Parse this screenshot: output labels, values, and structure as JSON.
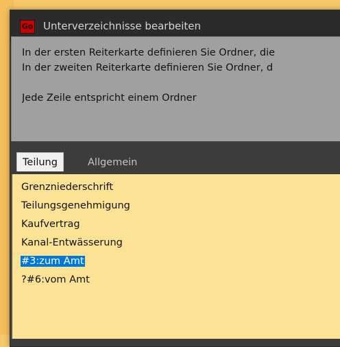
{
  "window": {
    "icon_text": "Go",
    "title": "Unterverzeichnisse bearbeiten"
  },
  "description": {
    "line1": "In der ersten Reiterkarte definieren Sie Ordner, die",
    "line2": "In der zweiten Reiterkarte definieren Sie Ordner, d",
    "line3": "Jede Zeile entspricht einem Ordner"
  },
  "tabs": [
    {
      "label": "Teilung",
      "active": true
    },
    {
      "label": "Allgemein",
      "active": false
    }
  ],
  "folders": [
    "Grenzniederschrift",
    "Teilungsgenehmigung",
    "Kaufvertrag",
    "Kanal-Entwässerung",
    "#3:zum Amt",
    "?#6:vom Amt"
  ],
  "selected_index": 4,
  "colors": {
    "list_background": "#fbe294",
    "selection": "#0078d7",
    "app_icon": "#c80000"
  }
}
